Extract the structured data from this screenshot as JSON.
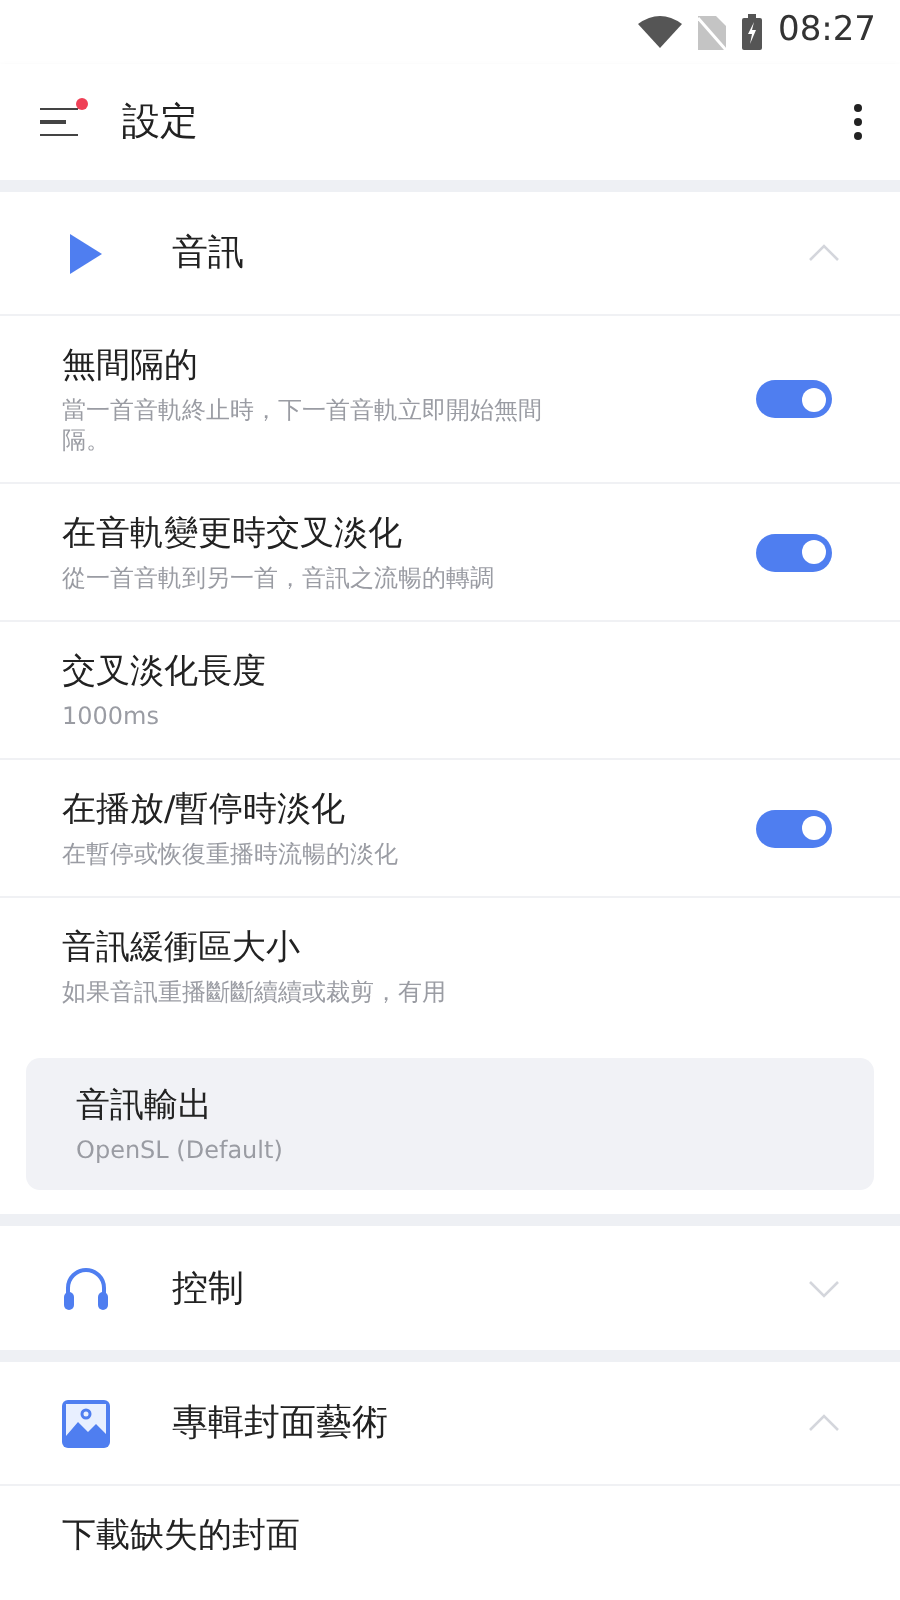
{
  "status_bar": {
    "time": "08:27"
  },
  "app_bar": {
    "title": "設定",
    "menu_badge": true
  },
  "sections": [
    {
      "kind": "play",
      "title": "音訊",
      "expanded": true,
      "items": [
        {
          "kind": "toggle",
          "title": "無間隔的",
          "subtitle": "當一首音軌終止時，下一首音軌立即開始無間隔。",
          "on": true
        },
        {
          "kind": "toggle",
          "title": "在音軌變更時交叉淡化",
          "subtitle": "從一首音軌到另一首，音訊之流暢的轉調",
          "on": true
        },
        {
          "kind": "value",
          "title": "交叉淡化長度",
          "subtitle": "1000ms"
        },
        {
          "kind": "toggle",
          "title": "在播放/暫停時淡化",
          "subtitle": "在暫停或恢復重播時流暢的淡化",
          "on": true
        },
        {
          "kind": "value",
          "title": "音訊緩衝區大小",
          "subtitle": "如果音訊重播斷斷續續或裁剪，有用"
        },
        {
          "kind": "card",
          "title": "音訊輸出",
          "subtitle": "OpenSL (Default)"
        }
      ]
    },
    {
      "kind": "headphones",
      "title": "控制",
      "expanded": false
    },
    {
      "kind": "image",
      "title": "專輯封面藝術",
      "expanded": true,
      "items": [
        {
          "kind": "value",
          "title": "下載缺失的封面"
        }
      ]
    }
  ]
}
